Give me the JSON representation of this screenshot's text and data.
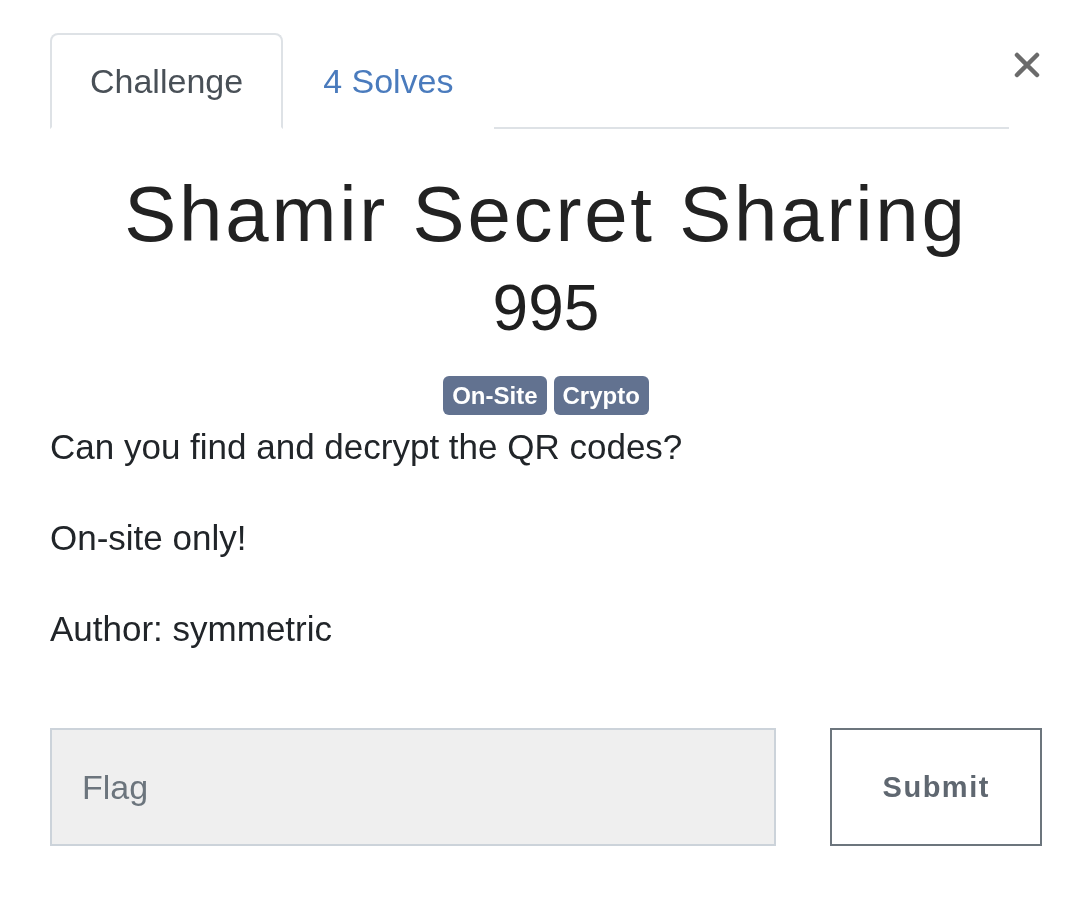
{
  "tabs": [
    {
      "label": "Challenge",
      "selected": true
    },
    {
      "label": "4 Solves",
      "selected": false
    }
  ],
  "challenge": {
    "title": "Shamir Secret Sharing",
    "points": "995",
    "tags": [
      "On-Site",
      "Crypto"
    ],
    "description": [
      "Can you find and decrypt the QR codes?",
      "On-site only!",
      "Author: symmetric"
    ]
  },
  "flag_form": {
    "placeholder": "Flag",
    "submit": "Submit"
  }
}
